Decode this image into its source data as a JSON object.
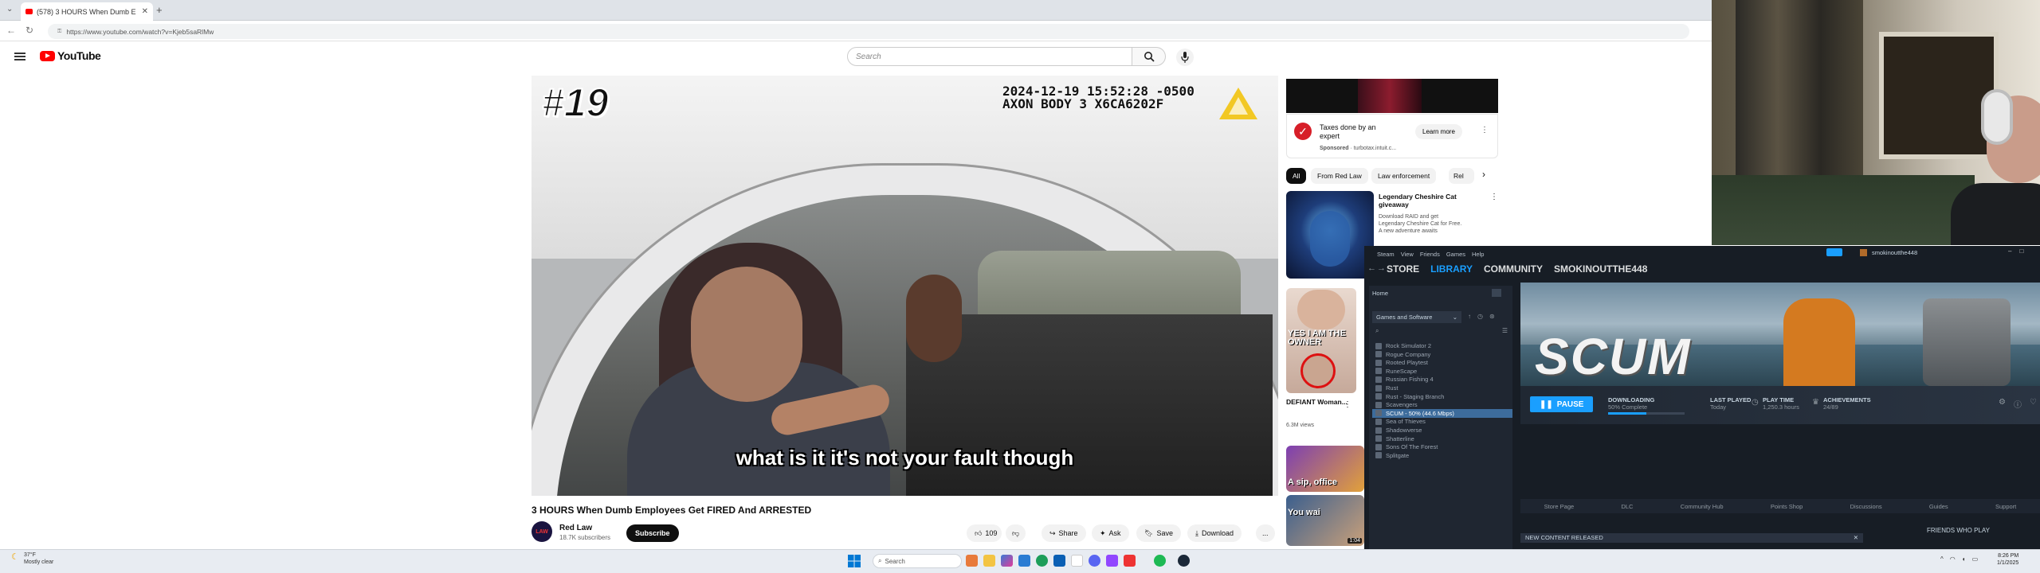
{
  "browser": {
    "tab_title": "(578) 3 HOURS When Dumb E",
    "url": "https://www.youtube.com/watch?v=Kjeb5saRlMw"
  },
  "youtube": {
    "logo": "YouTube",
    "search_placeholder": "Search",
    "video": {
      "episode_overlay": "#19",
      "bodycam_stamp_line1": "2024-12-19 15:52:28 -0500",
      "bodycam_stamp_line2": "AXON BODY 3 X6CA6202F",
      "caption": "what is it it's not your fault though",
      "title": "3 HOURS When Dumb Employees Get FIRED And ARRESTED"
    },
    "channel": {
      "avatar_text": "LAW",
      "name": "Red Law",
      "subscribers": "18.7K subscribers",
      "subscribe_label": "Subscribe"
    },
    "actions": {
      "likes": "109",
      "share": "Share",
      "ask": "Ask",
      "save": "Save",
      "download": "Download",
      "more": "..."
    },
    "ad": {
      "headline": "Taxes done by an expert",
      "sponsored": "Sponsored",
      "advertiser": "turbotax.intuit.c...",
      "cta": "Learn more"
    },
    "chips": [
      "All",
      "From Red Law",
      "Law enforcement",
      "Rel"
    ],
    "recommendations": [
      {
        "title": "Legendary Cheshire Cat giveaway",
        "desc": "Download RAID and get Legendary Cheshire Cat for Free. A new adventure awaits"
      },
      {
        "thumb_text": "YES I AM THE OWNER",
        "title": "DEFIANT Woman...",
        "views": "6.3M views"
      },
      {
        "thumb_text": "A sip, office",
        "thumb_text2": "You wai",
        "duration": "1:04"
      }
    ]
  },
  "steam": {
    "menu": [
      "Steam",
      "View",
      "Friends",
      "Games",
      "Help"
    ],
    "nav": [
      "STORE",
      "LIBRARY",
      "COMMUNITY",
      "SMOKINOUTTHE448"
    ],
    "profile_name": "smokinoutthe448",
    "home": "Home",
    "filter": "Games and Software",
    "library_items": [
      "Rock Simulator 2",
      "Rogue Company",
      "Rooted Playtest",
      "RuneScape",
      "Russian Fishing 4",
      "Rust",
      "Rust - Staging Branch",
      "Scavengers",
      "SCUM - 50% (44.6 Mbps)",
      "Sea of Thieves",
      "Shadowverse",
      "Shatterline",
      "Sons Of The Forest",
      "Splitgate"
    ],
    "selected_index": 8,
    "hero_logo": "SCUM",
    "pause_label": "PAUSE",
    "downloading_label": "DOWNLOADING",
    "downloading_value": "50% Complete",
    "downloading_fraction": 0.5,
    "last_played_label": "LAST PLAYED",
    "last_played_value": "Today",
    "playtime_label": "PLAY TIME",
    "playtime_value": "1,250.3 hours",
    "achievements_label": "ACHIEVEMENTS",
    "achievements_value": "24/89",
    "game_tabs": [
      "Store Page",
      "DLC",
      "Community Hub",
      "Points Shop",
      "Discussions",
      "Guides",
      "Support"
    ],
    "new_content": "NEW CONTENT RELEASED",
    "friends_who_play": "FRIENDS WHO PLAY"
  },
  "taskbar": {
    "weather_temp": "37°F",
    "weather_desc": "Mostly clear",
    "search": "Search",
    "time": "8:26 PM",
    "date": "1/1/2025"
  },
  "colors": {
    "youtube_red": "#ff0000",
    "steam_accent": "#1a9fff",
    "steam_bg": "#171d25"
  }
}
